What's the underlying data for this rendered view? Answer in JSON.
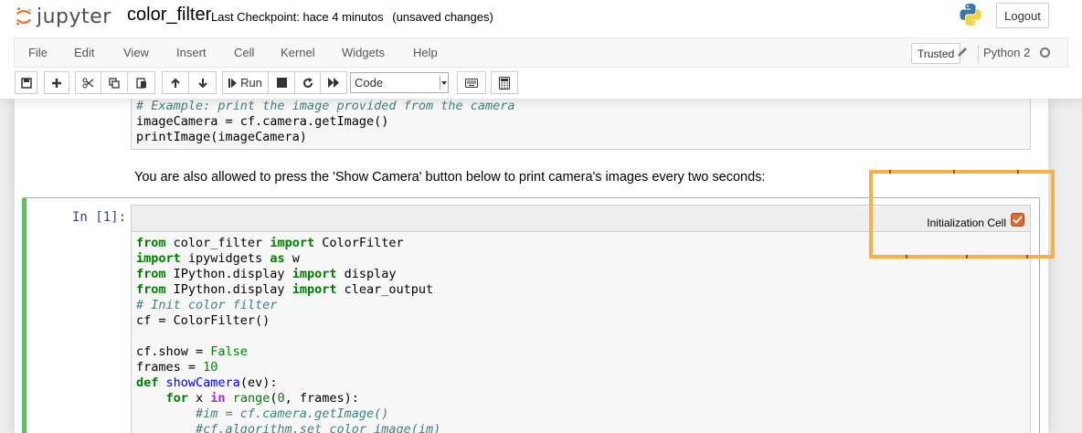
{
  "header": {
    "logo_text": "jupyter",
    "notebook_name": "color_filter",
    "checkpoint": "Last Checkpoint: hace 4 minutos",
    "unsaved": "(unsaved changes)",
    "logout_label": "Logout"
  },
  "menubar": {
    "items": [
      "File",
      "Edit",
      "View",
      "Insert",
      "Cell",
      "Kernel",
      "Widgets",
      "Help"
    ],
    "trusted_label": "Trusted",
    "kernel_name": "Python 2"
  },
  "toolbar": {
    "run_label": "Run",
    "cell_type": "Code"
  },
  "notebook": {
    "previous_cell_lines": [
      "# Example: print the image provided from the camera",
      "imageCamera = cf.camera.getImage()",
      "printImage(imageCamera)"
    ],
    "markdown_text": "You are also allowed to press the 'Show Camera' button below to print camera's images every two seconds:",
    "selected_cell": {
      "prompt": "In [1]:",
      "tag_label": "Initialization Cell",
      "tag_checked": true,
      "code_lines": [
        "from color_filter import ColorFilter",
        "import ipywidgets as w",
        "from IPython.display import display",
        "from IPython.display import clear_output",
        "# Init color filter",
        "cf = ColorFilter()",
        "",
        "cf.show = False",
        "frames = 10",
        "def showCamera(ev):",
        "    for x in range(0, frames):",
        "        #im = cf.camera.getImage()",
        "        #cf.algorithm.set_color_image(im)"
      ]
    }
  },
  "colors": {
    "selected_border": "#66bb6a",
    "highlight": "#f6b04a",
    "checkbox": "#e2692e"
  }
}
